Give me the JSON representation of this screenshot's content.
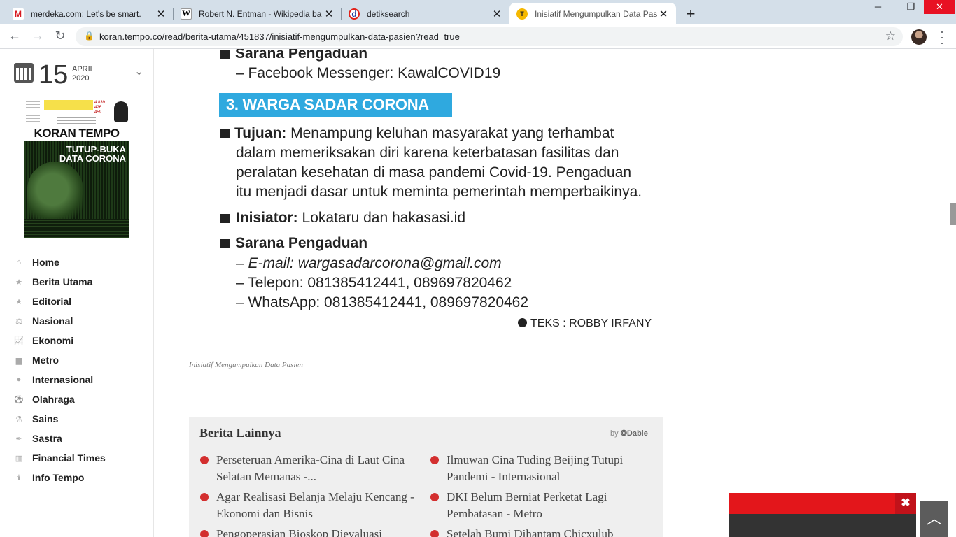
{
  "browser": {
    "tabs": [
      {
        "title": "merdeka.com: Let's be smart.",
        "favicon": "M"
      },
      {
        "title": "Robert N. Entman - Wikipedia ba",
        "favicon": "W"
      },
      {
        "title": "detiksearch",
        "favicon": "d"
      },
      {
        "title": "Inisiatif Mengumpulkan Data Pas",
        "favicon": "T",
        "active": true
      }
    ],
    "new_tab": "+",
    "url": "koran.tempo.co/read/berita-utama/451837/inisiatif-mengumpulkan-data-pasien?read=true"
  },
  "sidebar": {
    "day": "15",
    "month": "APRIL",
    "year": "2020",
    "cover": {
      "brand": "KORAN TEMPO",
      "headline_1": "TUTUP-BUKA",
      "headline_2": "DATA CORONA",
      "numbers": "4.839\n426\n459"
    },
    "menu": [
      {
        "label": "Home",
        "icon": "home-icon",
        "glyph": "⌂"
      },
      {
        "label": "Berita Utama",
        "icon": "star-icon",
        "glyph": "★"
      },
      {
        "label": "Editorial",
        "icon": "star-icon",
        "glyph": "★"
      },
      {
        "label": "Nasional",
        "icon": "scale-icon",
        "glyph": "⚖"
      },
      {
        "label": "Ekonomi",
        "icon": "chart-line-icon",
        "glyph": "📈"
      },
      {
        "label": "Metro",
        "icon": "building-icon",
        "glyph": "▆"
      },
      {
        "label": "Internasional",
        "icon": "globe-icon",
        "glyph": "●"
      },
      {
        "label": "Olahraga",
        "icon": "ball-icon",
        "glyph": "⚽"
      },
      {
        "label": "Sains",
        "icon": "flask-icon",
        "glyph": "⚗"
      },
      {
        "label": "Sastra",
        "icon": "pen-icon",
        "glyph": "✒"
      },
      {
        "label": "Financial Times",
        "icon": "bar-chart-icon",
        "glyph": "▥"
      },
      {
        "label": "Info Tempo",
        "icon": "info-icon",
        "glyph": "ℹ"
      }
    ]
  },
  "infographic": {
    "top_heading": "Sarana Pengaduan",
    "top_line": "– Facebook Messenger: KawalCOVID19",
    "banner": "3. WARGA SADAR CORONA",
    "tujuan_label": "Tujuan:",
    "tujuan_lines": [
      "Menampung keluhan masyarakat yang terhambat",
      "dalam memeriksakan diri karena keterbatasan fasilitas dan",
      "peralatan kesehatan di masa pandemi Covid-19. Pengaduan",
      "itu menjadi dasar untuk meminta pemerintah memperbaikinya."
    ],
    "inisiator_label": "Inisiator:",
    "inisiator_value": "Lokataru dan hakasasi.id",
    "sarana_heading": "Sarana Pengaduan",
    "email_prefix": "– ",
    "email_label": "E-mail",
    "email_value": ": wargasadarcorona@gmail.com",
    "telepon": "– Telepon: 081385412441, 089697820462",
    "whatsapp": "– WhatsApp: 081385412441, 089697820462",
    "credit": "TEKS : ROBBY IRFANY"
  },
  "caption": "Inisiatif Mengumpulkan Data Pasien",
  "related": {
    "title": "Berita Lainnya",
    "by": "by",
    "brand": "Dable",
    "items": [
      {
        "text": "Perseteruan Amerika-Cina di Laut Cina Selatan Memanas -..."
      },
      {
        "text": "Ilmuwan Cina Tuding Beijing Tutupi Pandemi - Internasional"
      },
      {
        "text": "Agar Realisasi Belanja Melaju Kencang - Ekonomi dan Bisnis"
      },
      {
        "text": "DKI Belum Berniat Perketat Lagi Pembatasan - Metro"
      },
      {
        "text": "Pengoperasian Bioskop Dievaluasi"
      },
      {
        "text": "Setelah Bumi Dihantam Chicxulub"
      }
    ]
  },
  "colors": {
    "banner": "#2fa9df",
    "ad_red": "#e3161b",
    "dot_red": "#d32f2f"
  }
}
